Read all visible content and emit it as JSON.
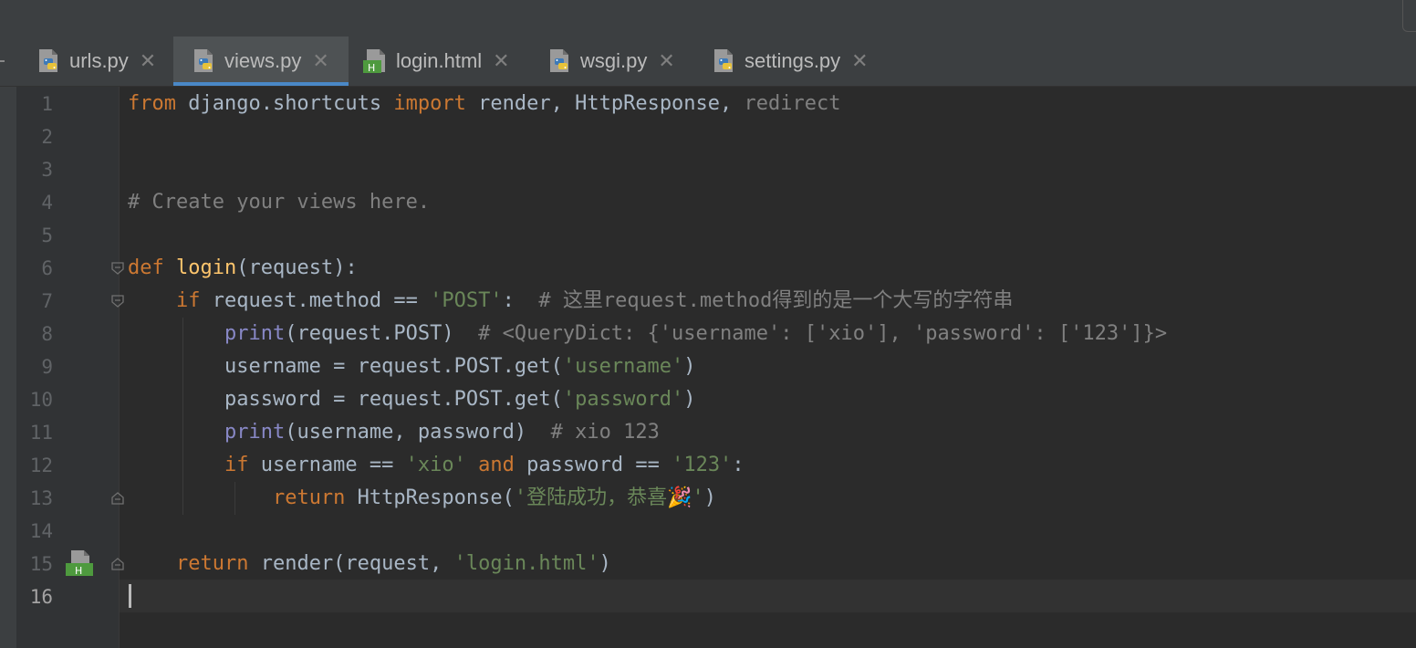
{
  "tabs": [
    {
      "label": "urls.py",
      "icon": "python-file-icon",
      "active": false
    },
    {
      "label": "views.py",
      "icon": "python-file-icon",
      "active": true
    },
    {
      "label": "login.html",
      "icon": "html-file-icon",
      "active": false
    },
    {
      "label": "wsgi.py",
      "icon": "python-file-icon",
      "active": false
    },
    {
      "label": "settings.py",
      "icon": "python-file-icon",
      "active": false
    }
  ],
  "close_glyph": "✕",
  "line_numbers": [
    "1",
    "2",
    "3",
    "4",
    "5",
    "6",
    "7",
    "8",
    "9",
    "10",
    "11",
    "12",
    "13",
    "14",
    "15",
    "16"
  ],
  "code": {
    "l1": {
      "from": "from",
      "mod": " django.shortcuts ",
      "import": "import",
      "names": " render, HttpResponse, ",
      "unused": "redirect"
    },
    "l4": {
      "comment": "# Create your views here."
    },
    "l6": {
      "def": "def",
      "sp": " ",
      "fname": "login",
      "rest": "(request):"
    },
    "l7": {
      "indent": "    ",
      "if": "if",
      "expr": " request.method == ",
      "str": "'POST'",
      "colon": ":  ",
      "comment": "# 这里request.method得到的是一个大写的字符串"
    },
    "l8": {
      "indent": "        ",
      "print": "print",
      "args": "(request.POST)  ",
      "comment": "# <QueryDict: {'username': ['xio'], 'password': ['123']}>"
    },
    "l9": {
      "indent": "        ",
      "code": "username = request.POST.get(",
      "str": "'username'",
      "close": ")"
    },
    "l10": {
      "indent": "        ",
      "code": "password = request.POST.get(",
      "str": "'password'",
      "close": ")"
    },
    "l11": {
      "indent": "        ",
      "print": "print",
      "args": "(username, password)  ",
      "comment": "# xio 123"
    },
    "l12": {
      "indent": "        ",
      "if": "if",
      "a": " username == ",
      "s1": "'xio'",
      "sp": " ",
      "and": "and",
      "b": " password == ",
      "s2": "'123'",
      "colon": ":"
    },
    "l13": {
      "indent": "            ",
      "return": "return",
      "call": " HttpResponse(",
      "str": "'登陆成功，恭喜🎉'",
      "close": ")"
    },
    "l15": {
      "indent": "    ",
      "return": "return",
      "call": " render(request, ",
      "str": "'login.html'",
      "close": ")"
    }
  },
  "colors": {
    "background": "#2b2b2b",
    "keyword": "#cc7832",
    "string": "#6a8759",
    "comment": "#808080",
    "function": "#ffc66d",
    "builtin": "#8888c6",
    "text": "#a9b7c6",
    "tab_active_underline": "#4a88c7"
  }
}
